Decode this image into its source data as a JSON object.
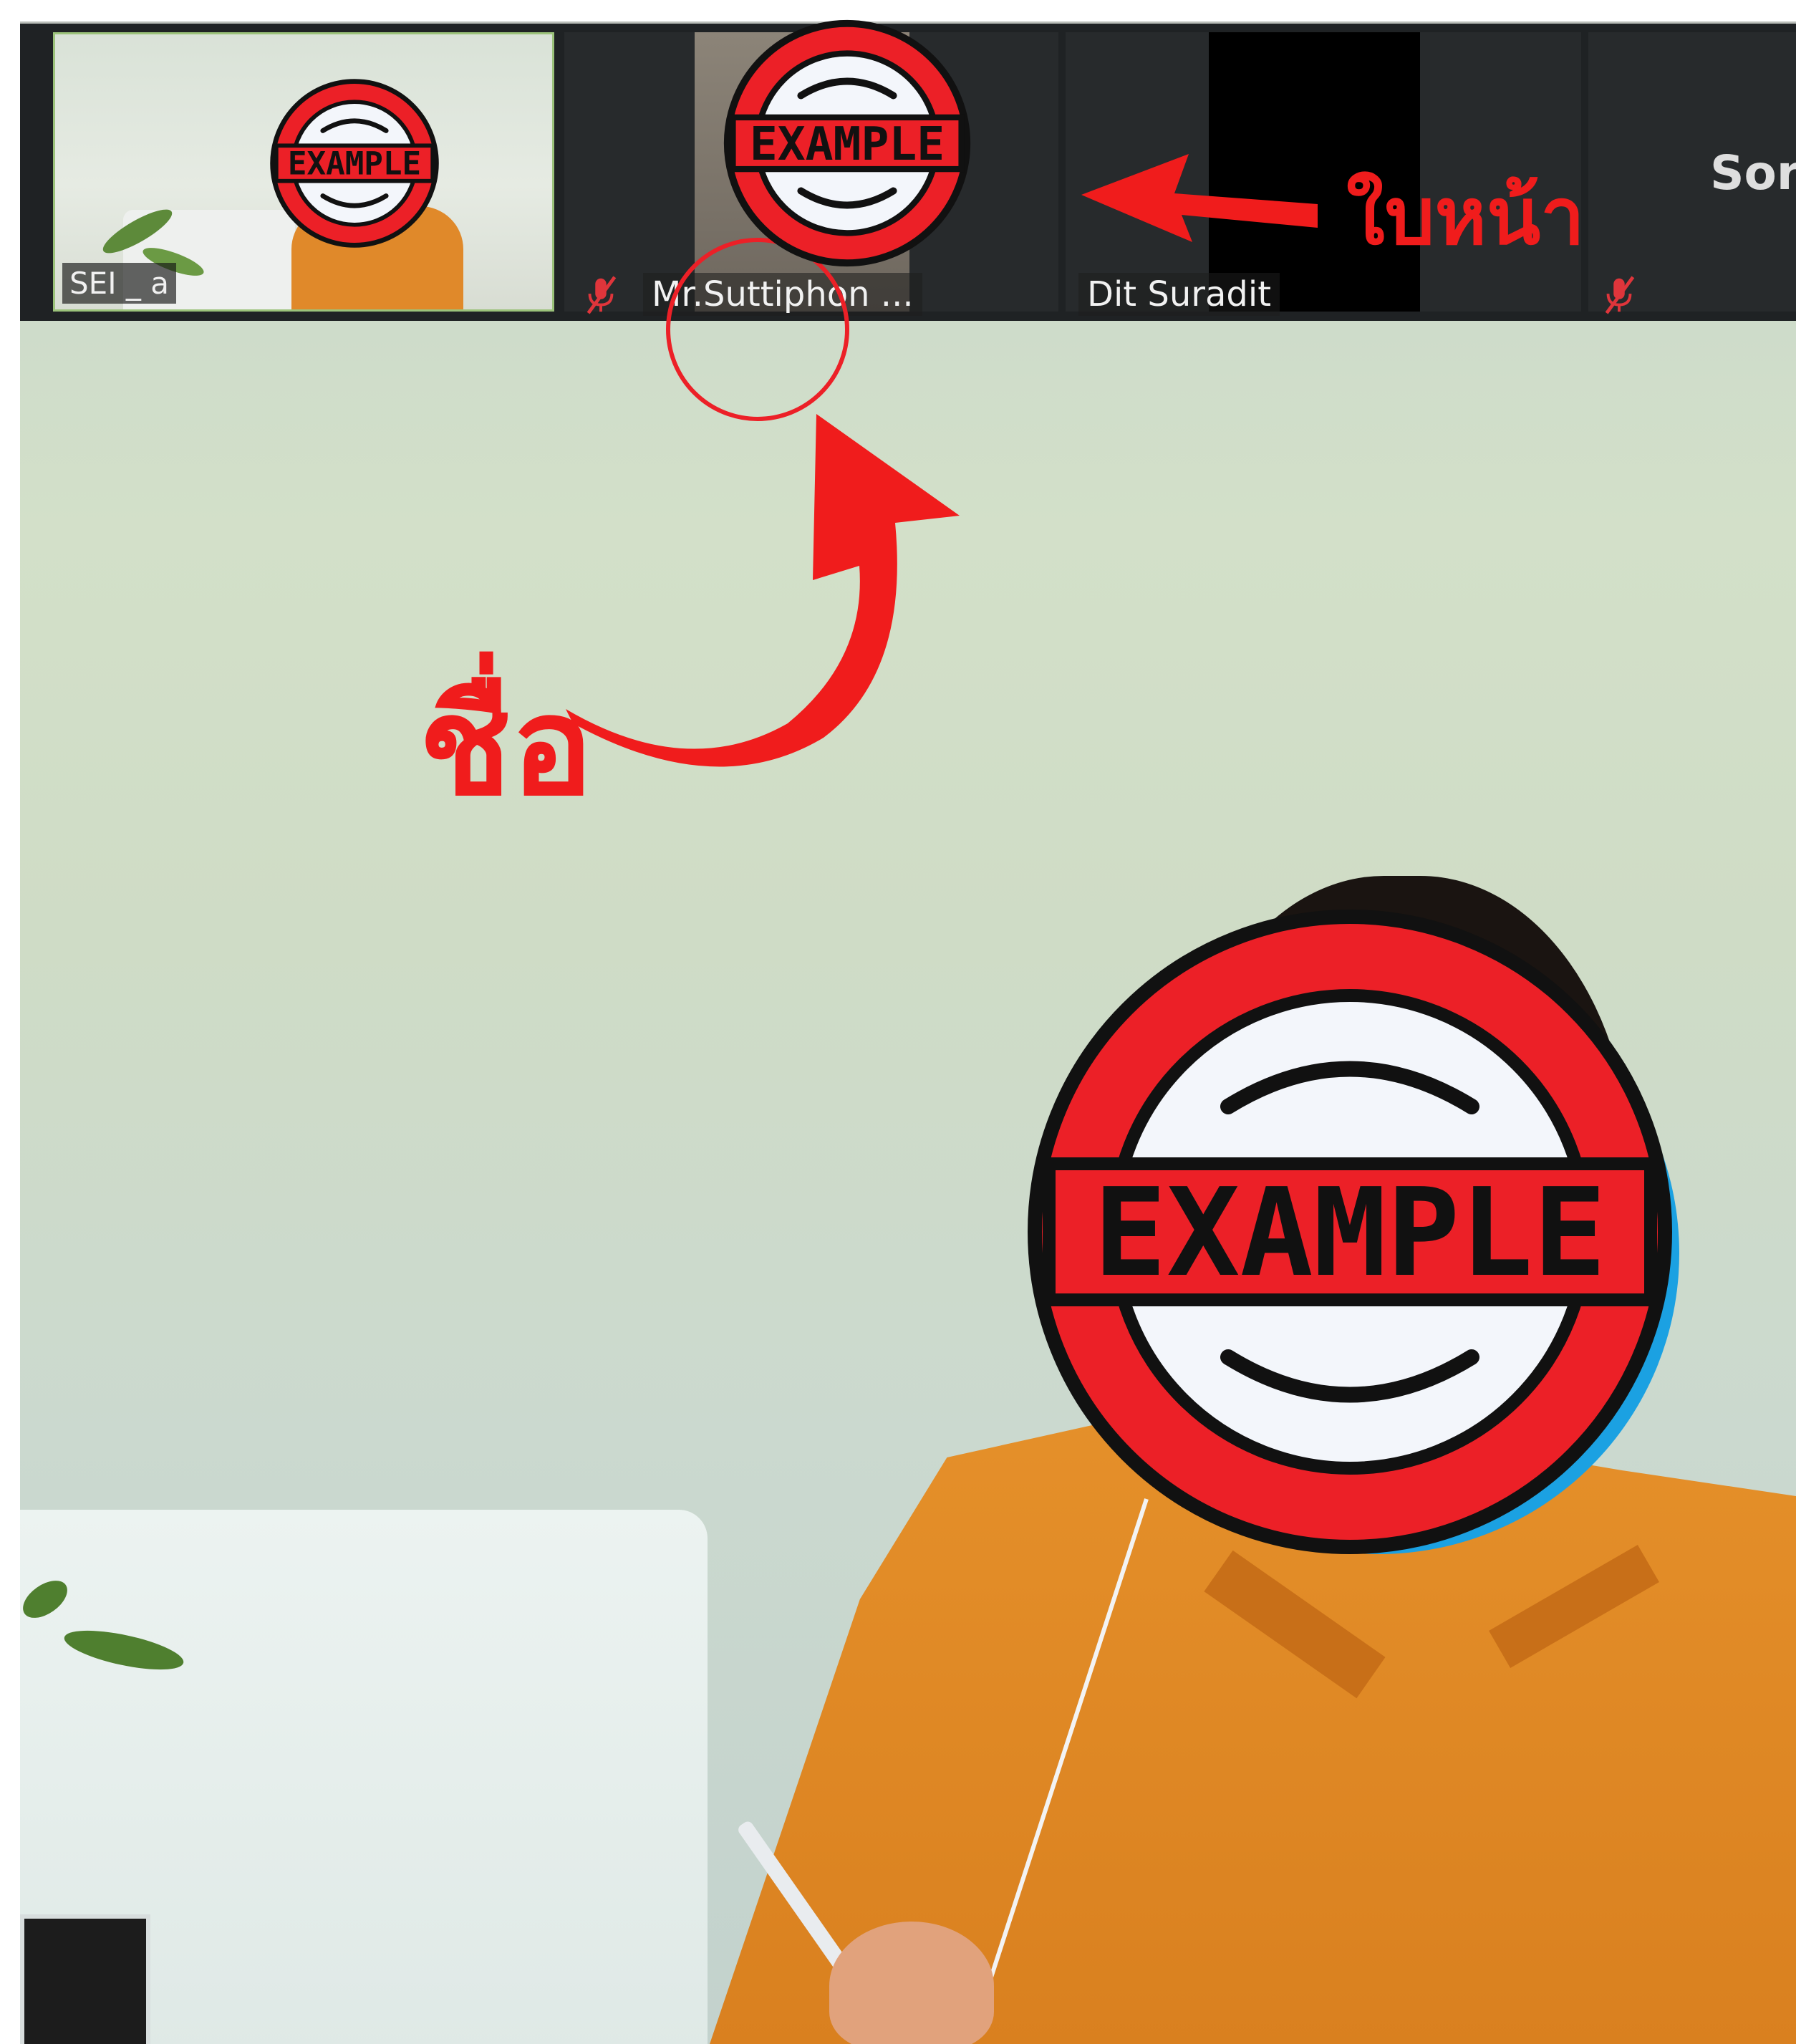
{
  "participants": [
    {
      "name": "SEI _ a",
      "muted": false,
      "video_on": true
    },
    {
      "name": "Mr.Suttiphon ...",
      "muted": true,
      "video_on": true
    },
    {
      "name": "Dit Suradit",
      "muted": false,
      "video_on": false
    },
    {
      "name": "Sor",
      "muted": true,
      "video_on": false
    }
  ],
  "annotations": {
    "face_label": "ใบหน้า",
    "name_label": "ชื่อ"
  },
  "stamp_text": "EXAMPLE",
  "colors": {
    "annotation_red": "#f01c1c",
    "stamp_red": "#ec2027",
    "stamp_blue": "#1ba1e2",
    "active_speaker_border": "#9bc27a",
    "muted_mic_red": "#e0353b",
    "strip_background": "#1f2224"
  },
  "icons": {
    "muted_mic": "muted-mic-icon",
    "face_arrow": "left-arrow-icon",
    "name_arrow": "curved-arrow-icon",
    "highlight": "circle-highlight"
  }
}
